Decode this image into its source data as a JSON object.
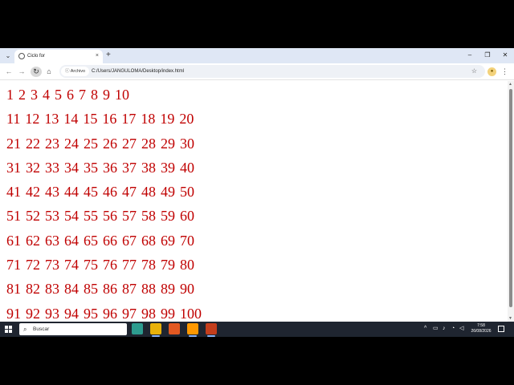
{
  "browser": {
    "tab_title": "Ciclo for",
    "tab_close": "×",
    "new_tab": "+",
    "window_controls": {
      "minimize": "–",
      "restore": "❐",
      "close": "✕"
    },
    "site_info_label": "Archivo",
    "url": "C:/Users/JANGULOMA/Desktop/index.html"
  },
  "content": {
    "rows": [
      [
        "1",
        "2",
        "3",
        "4",
        "5",
        "6",
        "7",
        "8",
        "9",
        "10"
      ],
      [
        "11",
        "12",
        "13",
        "14",
        "15",
        "16",
        "17",
        "18",
        "19",
        "20"
      ],
      [
        "21",
        "22",
        "23",
        "24",
        "25",
        "26",
        "27",
        "28",
        "29",
        "30"
      ],
      [
        "31",
        "32",
        "33",
        "34",
        "35",
        "36",
        "37",
        "38",
        "39",
        "40"
      ],
      [
        "41",
        "42",
        "43",
        "44",
        "45",
        "46",
        "47",
        "48",
        "49",
        "50"
      ],
      [
        "51",
        "52",
        "53",
        "54",
        "55",
        "56",
        "57",
        "58",
        "59",
        "60"
      ],
      [
        "61",
        "62",
        "63",
        "64",
        "65",
        "66",
        "67",
        "68",
        "69",
        "70"
      ],
      [
        "71",
        "72",
        "73",
        "74",
        "75",
        "76",
        "77",
        "78",
        "79",
        "80"
      ],
      [
        "81",
        "82",
        "83",
        "84",
        "85",
        "86",
        "87",
        "88",
        "89",
        "90"
      ],
      [
        "91",
        "92",
        "93",
        "94",
        "95",
        "96",
        "97",
        "98",
        "99",
        "100"
      ]
    ],
    "number_color": "#c00000"
  },
  "taskbar": {
    "search_placeholder": "Buscar",
    "clock_time": "7:58",
    "clock_date": "26/08/2026",
    "apps": [
      {
        "name": "widgets",
        "color": "#2d9c8f"
      },
      {
        "name": "chrome",
        "color": "#e8b10a"
      },
      {
        "name": "firefox",
        "color": "#e25821"
      },
      {
        "name": "sublime-text",
        "color": "#ff9800"
      },
      {
        "name": "powerpoint",
        "color": "#c43e1c"
      }
    ]
  }
}
